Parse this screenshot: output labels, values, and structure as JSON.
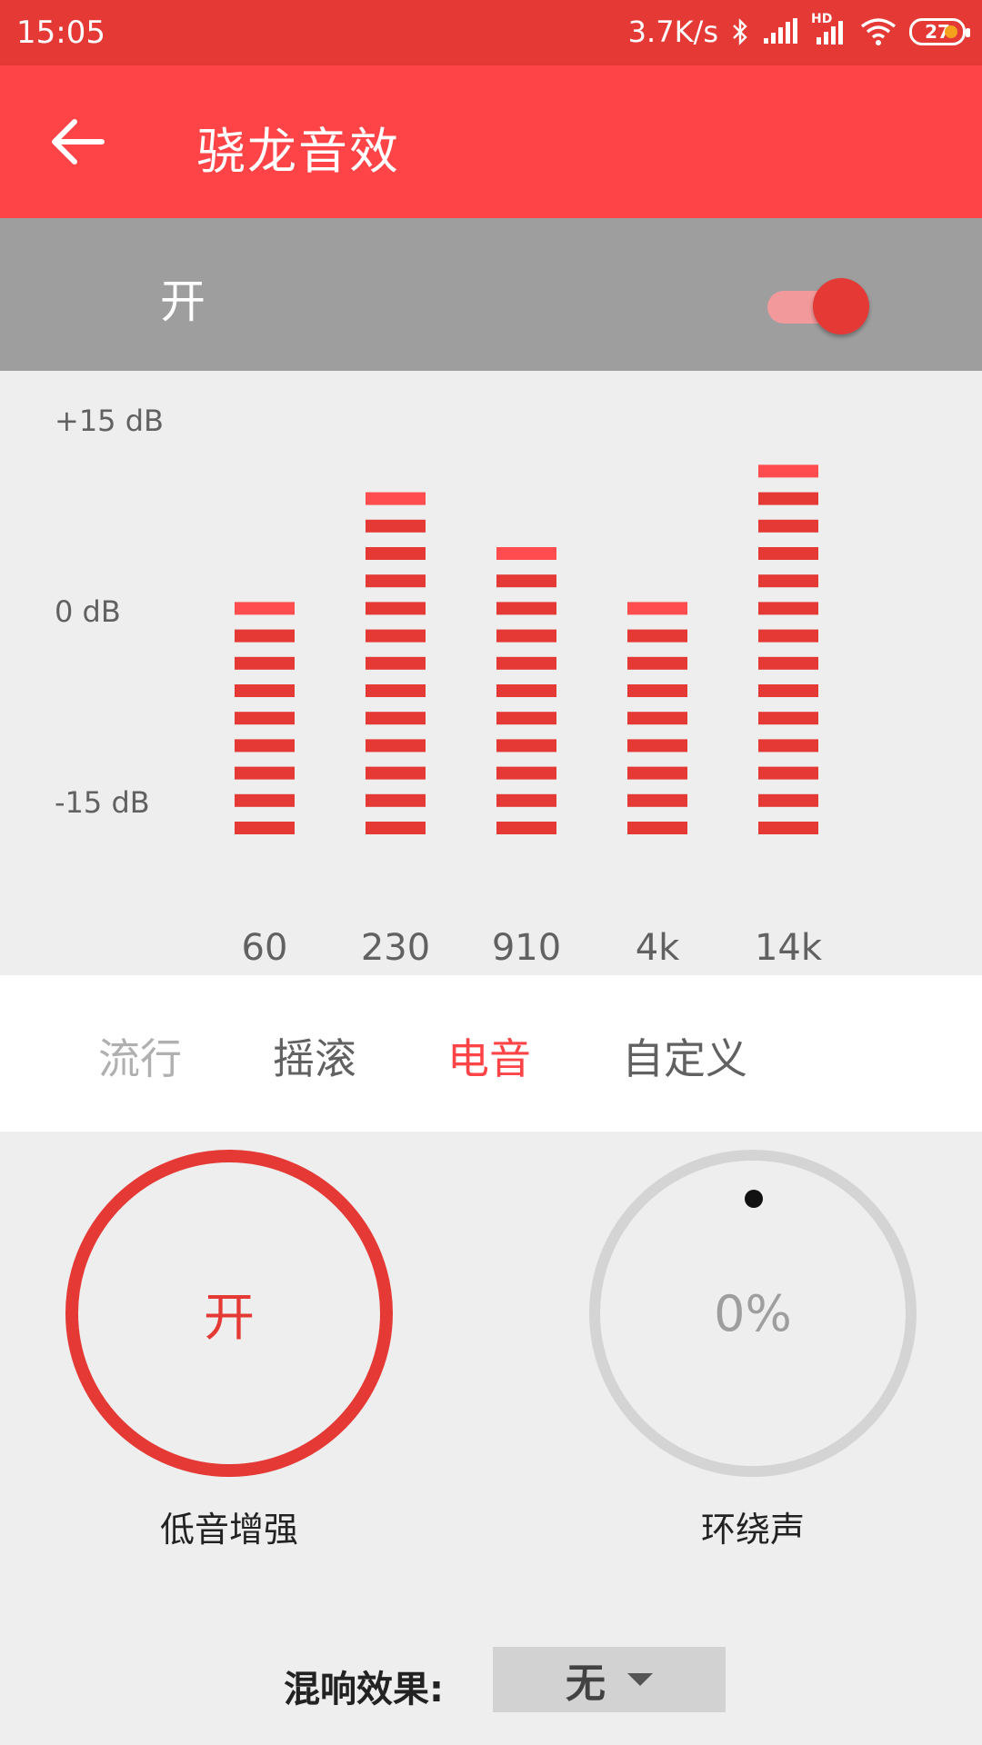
{
  "status_bar": {
    "time": "15:05",
    "net_speed": "3.7K/s",
    "hd": "HD",
    "battery": "27"
  },
  "app_bar": {
    "title": "骁龙音效"
  },
  "master_toggle": {
    "label": "开",
    "on": true
  },
  "equalizer": {
    "db_labels": {
      "top": "+15 dB",
      "mid": "0 dB",
      "bottom": "-15 dB"
    },
    "max_segments": 14,
    "bands": [
      {
        "label": "60",
        "segments": 9
      },
      {
        "label": "230",
        "segments": 13
      },
      {
        "label": "910",
        "segments": 11
      },
      {
        "label": "4k",
        "segments": 9
      },
      {
        "label": "14k",
        "segments": 14
      }
    ]
  },
  "presets": [
    {
      "label": "流行",
      "state": "inactive"
    },
    {
      "label": "摇滚",
      "state": "normal"
    },
    {
      "label": "电音",
      "state": "active"
    },
    {
      "label": "自定义",
      "state": "normal"
    }
  ],
  "bass_boost": {
    "value": "开",
    "label": "低音增强"
  },
  "surround": {
    "value": "0%",
    "label": "环绕声"
  },
  "reverb": {
    "label": "混响效果:",
    "value": "无"
  },
  "colors": {
    "accent": "#e53935",
    "appbar": "#ff4447",
    "segment_top": "#ff4d4f"
  }
}
